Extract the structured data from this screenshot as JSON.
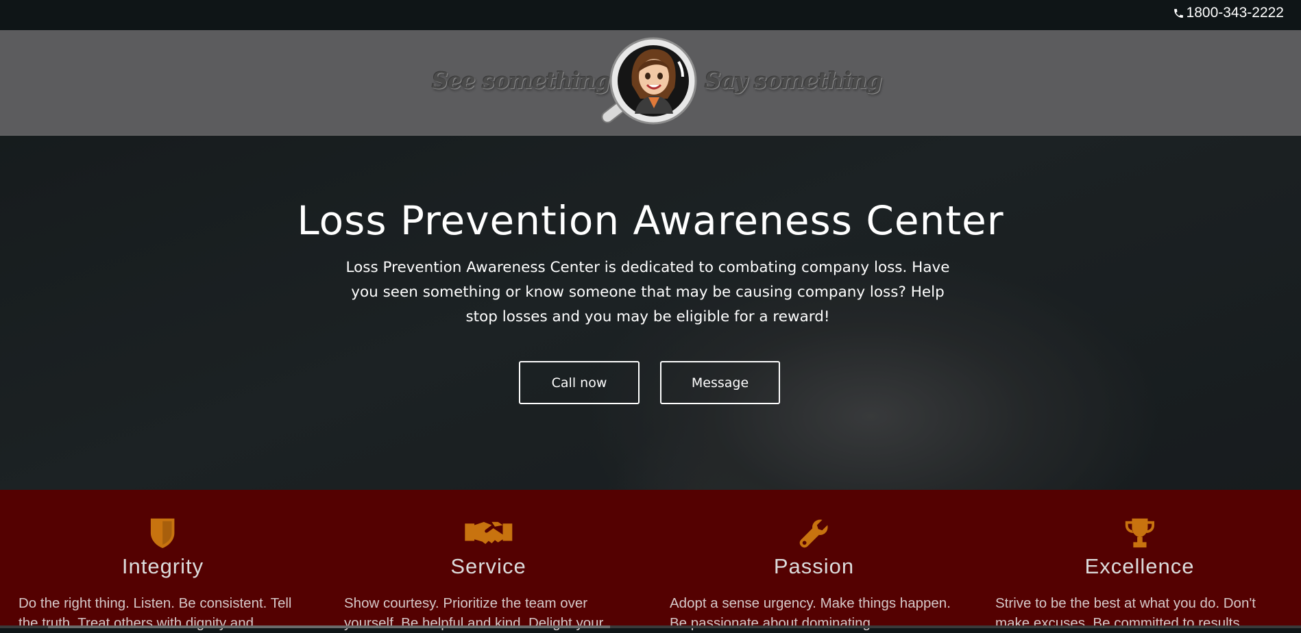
{
  "topbar": {
    "phone": "1800-343-2222",
    "icon": "phone-icon"
  },
  "header": {
    "tagline_left": "See something",
    "tagline_right": "Say something",
    "logo_icon": "magnifying-glass-mascot-icon"
  },
  "hero": {
    "title": "Loss Prevention Awareness Center",
    "text": "Loss Prevention Awareness Center is dedicated to combating company loss. Have you seen something or know someone that may be causing company loss? Help stop losses and you may be eligible for a reward!",
    "buttons": {
      "call": "Call now",
      "message": "Message"
    }
  },
  "values": [
    {
      "icon": "shield-icon",
      "title": "Integrity",
      "text": "Do the right thing. Listen. Be consistent. Tell the truth. Treat others with dignity and"
    },
    {
      "icon": "handshake-icon",
      "title": "Service",
      "text": "Show courtesy. Prioritize the team over yourself. Be helpful and kind. Delight your"
    },
    {
      "icon": "wrench-icon",
      "title": "Passion",
      "text": "Adopt a sense urgency. Make things happen. Be passionate about dominating"
    },
    {
      "icon": "trophy-icon",
      "title": "Excellence",
      "text": "Strive to be the best at what you do. Don't make excuses. Be committed to results."
    }
  ],
  "colors": {
    "accent": "#c8730f",
    "values_bg": "#540101",
    "header_bg": "#5c5c5e"
  }
}
